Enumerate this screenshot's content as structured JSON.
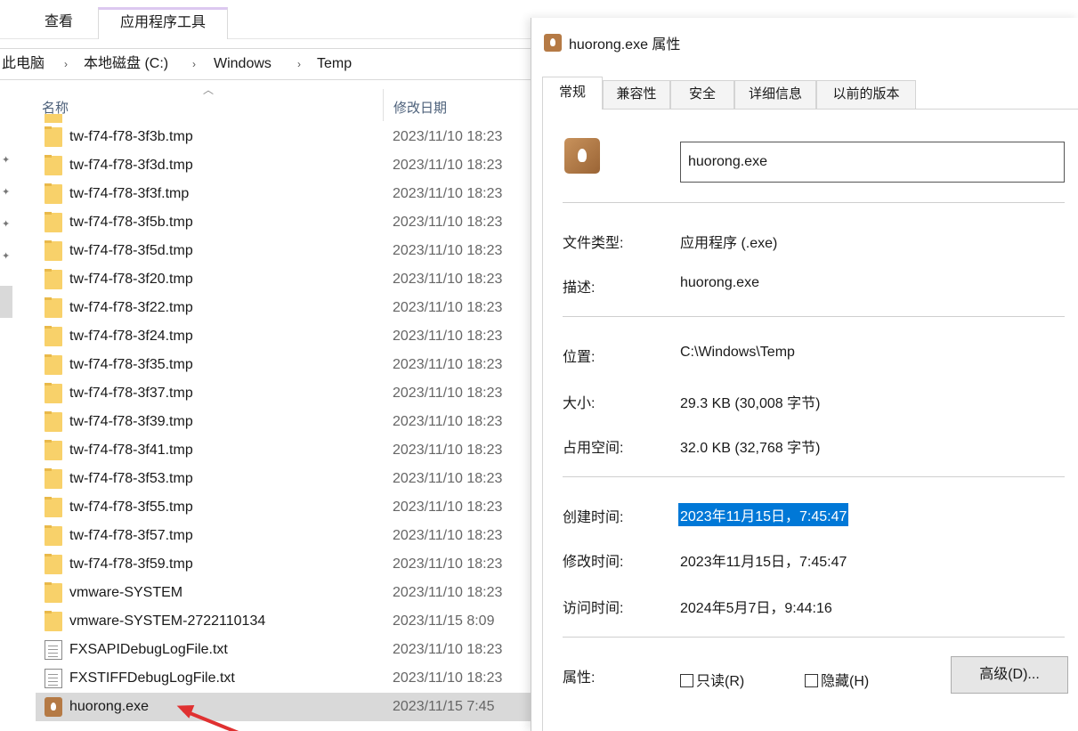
{
  "explorer": {
    "ribbon_tabs": [
      "查看",
      "应用程序工具"
    ],
    "breadcrumb": [
      "此电脑",
      "本地磁盘 (C:)",
      "Windows",
      "Temp"
    ],
    "columns": {
      "name": "名称",
      "date": "修改日期"
    },
    "files": [
      {
        "name": "tw-f74-f78-3f3b.tmp",
        "date": "2023/11/10 18:23",
        "type": "folder"
      },
      {
        "name": "tw-f74-f78-3f3d.tmp",
        "date": "2023/11/10 18:23",
        "type": "folder"
      },
      {
        "name": "tw-f74-f78-3f3f.tmp",
        "date": "2023/11/10 18:23",
        "type": "folder"
      },
      {
        "name": "tw-f74-f78-3f5b.tmp",
        "date": "2023/11/10 18:23",
        "type": "folder"
      },
      {
        "name": "tw-f74-f78-3f5d.tmp",
        "date": "2023/11/10 18:23",
        "type": "folder"
      },
      {
        "name": "tw-f74-f78-3f20.tmp",
        "date": "2023/11/10 18:23",
        "type": "folder"
      },
      {
        "name": "tw-f74-f78-3f22.tmp",
        "date": "2023/11/10 18:23",
        "type": "folder"
      },
      {
        "name": "tw-f74-f78-3f24.tmp",
        "date": "2023/11/10 18:23",
        "type": "folder"
      },
      {
        "name": "tw-f74-f78-3f35.tmp",
        "date": "2023/11/10 18:23",
        "type": "folder"
      },
      {
        "name": "tw-f74-f78-3f37.tmp",
        "date": "2023/11/10 18:23",
        "type": "folder"
      },
      {
        "name": "tw-f74-f78-3f39.tmp",
        "date": "2023/11/10 18:23",
        "type": "folder"
      },
      {
        "name": "tw-f74-f78-3f41.tmp",
        "date": "2023/11/10 18:23",
        "type": "folder"
      },
      {
        "name": "tw-f74-f78-3f53.tmp",
        "date": "2023/11/10 18:23",
        "type": "folder"
      },
      {
        "name": "tw-f74-f78-3f55.tmp",
        "date": "2023/11/10 18:23",
        "type": "folder"
      },
      {
        "name": "tw-f74-f78-3f57.tmp",
        "date": "2023/11/10 18:23",
        "type": "folder"
      },
      {
        "name": "tw-f74-f78-3f59.tmp",
        "date": "2023/11/10 18:23",
        "type": "folder"
      },
      {
        "name": "vmware-SYSTEM",
        "date": "2023/11/10 18:23",
        "type": "folder"
      },
      {
        "name": "vmware-SYSTEM-2722110134",
        "date": "2023/11/15 8:09",
        "type": "folder"
      },
      {
        "name": "FXSAPIDebugLogFile.txt",
        "date": "2023/11/10 18:23",
        "type": "txt"
      },
      {
        "name": "FXSTIFFDebugLogFile.txt",
        "date": "2023/11/10 18:23",
        "type": "txt"
      },
      {
        "name": "huorong.exe",
        "date": "2023/11/15 7:45",
        "type": "exe",
        "selected": true
      }
    ]
  },
  "dialog": {
    "title": "huorong.exe 属性",
    "tabs": [
      "常规",
      "兼容性",
      "安全",
      "详细信息",
      "以前的版本"
    ],
    "file_name": "huorong.exe",
    "rows": {
      "type_label": "文件类型:",
      "type_value": "应用程序 (.exe)",
      "desc_label": "描述:",
      "desc_value": "huorong.exe",
      "location_label": "位置:",
      "location_value": "C:\\Windows\\Temp",
      "size_label": "大小:",
      "size_value": "29.3 KB (30,008 字节)",
      "disk_label": "占用空间:",
      "disk_value": "32.0 KB (32,768 字节)",
      "created_label": "创建时间:",
      "created_value": "2023年11月15日，7:45:47",
      "modified_label": "修改时间:",
      "modified_value": "2023年11月15日，7:45:47",
      "accessed_label": "访问时间:",
      "accessed_value": "2024年5月7日，9:44:16",
      "attr_label": "属性:"
    },
    "readonly_label": "只读(R)",
    "hidden_label": "隐藏(H)",
    "advanced_label": "高级(D)..."
  }
}
